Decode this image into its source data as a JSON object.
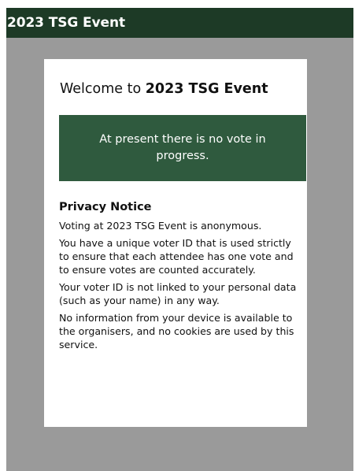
{
  "header": {
    "title": "2023 TSG Event"
  },
  "card": {
    "welcome_prefix": "Welcome to ",
    "event_name": "2023 TSG Event",
    "status_message": "At present there is no vote in progress."
  },
  "privacy": {
    "heading": "Privacy Notice",
    "paragraphs": [
      "Voting at 2023 TSG Event is anonymous.",
      "You have a unique voter ID that is used strictly to ensure that each attendee has one vote and to ensure votes are counted accurately.",
      "Your voter ID is not linked to your personal data (such as your name) in any way.",
      "No information from your device is available to the organisers, and no cookies are used by this service."
    ]
  },
  "colors": {
    "header_bg": "#1d3a26",
    "status_bg": "#2f5a3e",
    "backdrop": "#9a9a9a"
  }
}
